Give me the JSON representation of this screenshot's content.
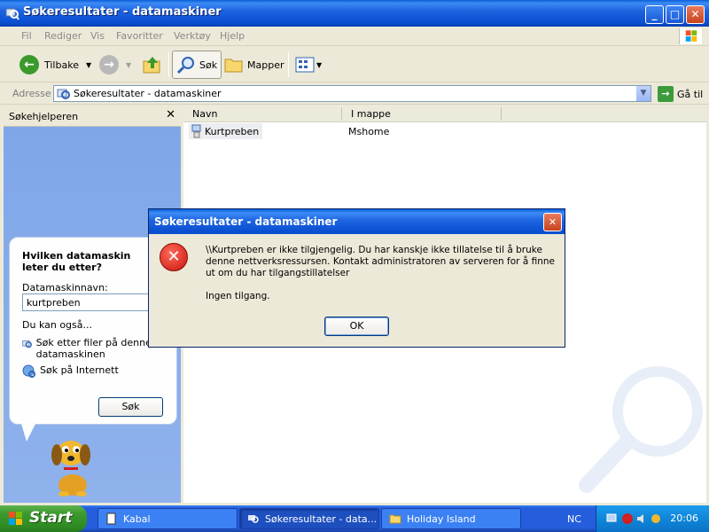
{
  "window": {
    "title": "Søkeresultater - datamaskiner",
    "controls": {
      "minimize": "_",
      "maximize": "□",
      "close": "✕"
    }
  },
  "menu": [
    "Fil",
    "Rediger",
    "Vis",
    "Favoritter",
    "Verktøy",
    "Hjelp"
  ],
  "toolbar": {
    "back": "Tilbake",
    "search": "Søk",
    "folders": "Mapper"
  },
  "address": {
    "label": "Adresse",
    "value": "Søkeresultater - datamaskiner",
    "goto": "Gå til"
  },
  "search_pane": {
    "title": "Søkehjelperen",
    "close": "✕",
    "question": "Hvilken datamaskin leter du etter?",
    "field_label": "Datamaskinnavn:",
    "field_value": "kurtpreben",
    "also_label": "Du kan også...",
    "options": [
      "Søk etter filer på denne datamaskinen",
      "Søk på Internett"
    ],
    "search_button": "Søk"
  },
  "results": {
    "columns": [
      "Navn",
      "I mappe"
    ],
    "rows": [
      {
        "name": "Kurtpreben",
        "folder": "Mshome"
      }
    ]
  },
  "dialog": {
    "title": "Søkeresultater - datamaskiner",
    "close": "✕",
    "message": "\\\\Kurtpreben er ikke tilgjengelig. Du har kanskje ikke tillatelse til å bruke denne nettverksressursen. Kontakt administratoren av serveren for å finne ut om du har tilgangstillatelser",
    "detail": "Ingen tilgang.",
    "ok": "OK"
  },
  "taskbar": {
    "start": "Start",
    "tasks": [
      "Kabal",
      "Søkeresultater - data...",
      "Holiday Island"
    ],
    "language": "NC",
    "clock": "20:06"
  },
  "colors": {
    "titlebar": "#0a4fd0",
    "taskbar": "#245edc",
    "start": "#3c9a2f",
    "error": "#c8140c"
  }
}
